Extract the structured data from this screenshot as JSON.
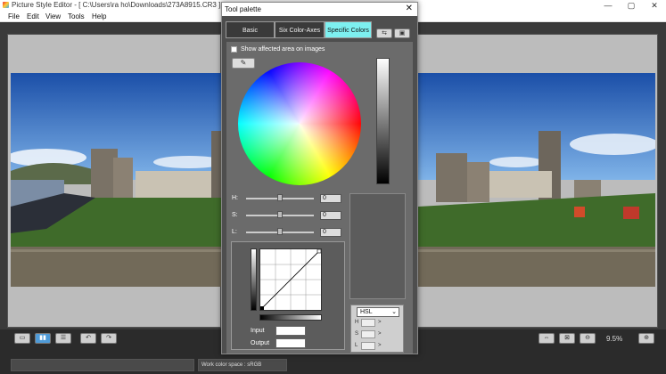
{
  "app": {
    "title": "Picture Style Editor - [ C:\\Users\\ra ho\\Downloads\\273A8915.CR3 ]",
    "window_controls": [
      "—",
      "▢",
      "✕"
    ]
  },
  "menu": {
    "file": "File",
    "edit": "Edit",
    "view": "View",
    "tools": "Tools",
    "help": "Help"
  },
  "palette": {
    "title": "Tool palette",
    "close": "✕",
    "tabs": {
      "basic": "Basic",
      "six_axes": "Six Color-Axes",
      "specific": "Specific Colors"
    },
    "show_affected": "Show affected area on images",
    "sliders": {
      "h_label": "H:",
      "h_value": "0",
      "s_label": "S:",
      "s_value": "0",
      "l_label": "L:",
      "l_value": "0"
    },
    "curve": {
      "input_label": "Input",
      "output_label": "Output"
    },
    "hsl": {
      "mode": "HSL",
      "h": "H",
      "s": "S",
      "l": "L",
      "arrow": ">"
    }
  },
  "statusbar": {
    "work_color_space": "Work color space : sRGB"
  },
  "toolbar": {
    "zoom": "9.5%"
  },
  "colors": {
    "active_tab": "#7df0f0",
    "window_bg": "#4e4e4e",
    "workspace_bg": "#3a3a3a"
  }
}
